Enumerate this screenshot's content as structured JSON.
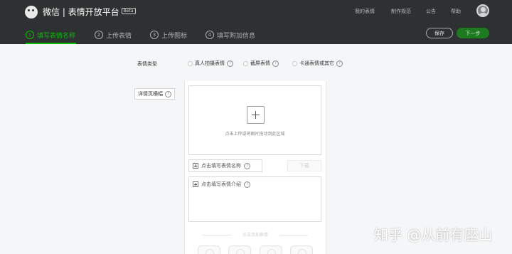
{
  "header": {
    "brand": "微信 | 表情开放平台",
    "beta": "Beta",
    "nav": [
      "我的表情",
      "制作规范",
      "公告",
      "帮助"
    ]
  },
  "steps": [
    {
      "num": "1",
      "label": "填写表情名称",
      "active": true
    },
    {
      "num": "2",
      "label": "上传表情",
      "active": false
    },
    {
      "num": "3",
      "label": "上传图标",
      "active": false
    },
    {
      "num": "4",
      "label": "填写附加信息",
      "active": false
    }
  ],
  "actions": {
    "save": "保存",
    "next": "下一步"
  },
  "form": {
    "type_label": "表情类型",
    "types": [
      "真人拍摄表情",
      "截屏表情",
      "卡通表情或其它"
    ],
    "detail_button": "详情页横幅",
    "upload_hint": "点击上传或将图片拖动到此区域",
    "name_placeholder": "点击填写表情名称",
    "download_label": "下载",
    "intro_placeholder": "点击填写表情介绍",
    "divider_text": "点击添加表情"
  },
  "help_glyph": "?",
  "icons": [
    "logo-icon",
    "avatar-icon",
    "help-icon",
    "plus-icon"
  ],
  "colors": {
    "header_bg": "#2e3132",
    "accent": "#09bb07",
    "page_bg": "#f5f6f7"
  },
  "watermark": "知乎 @从前有座山"
}
